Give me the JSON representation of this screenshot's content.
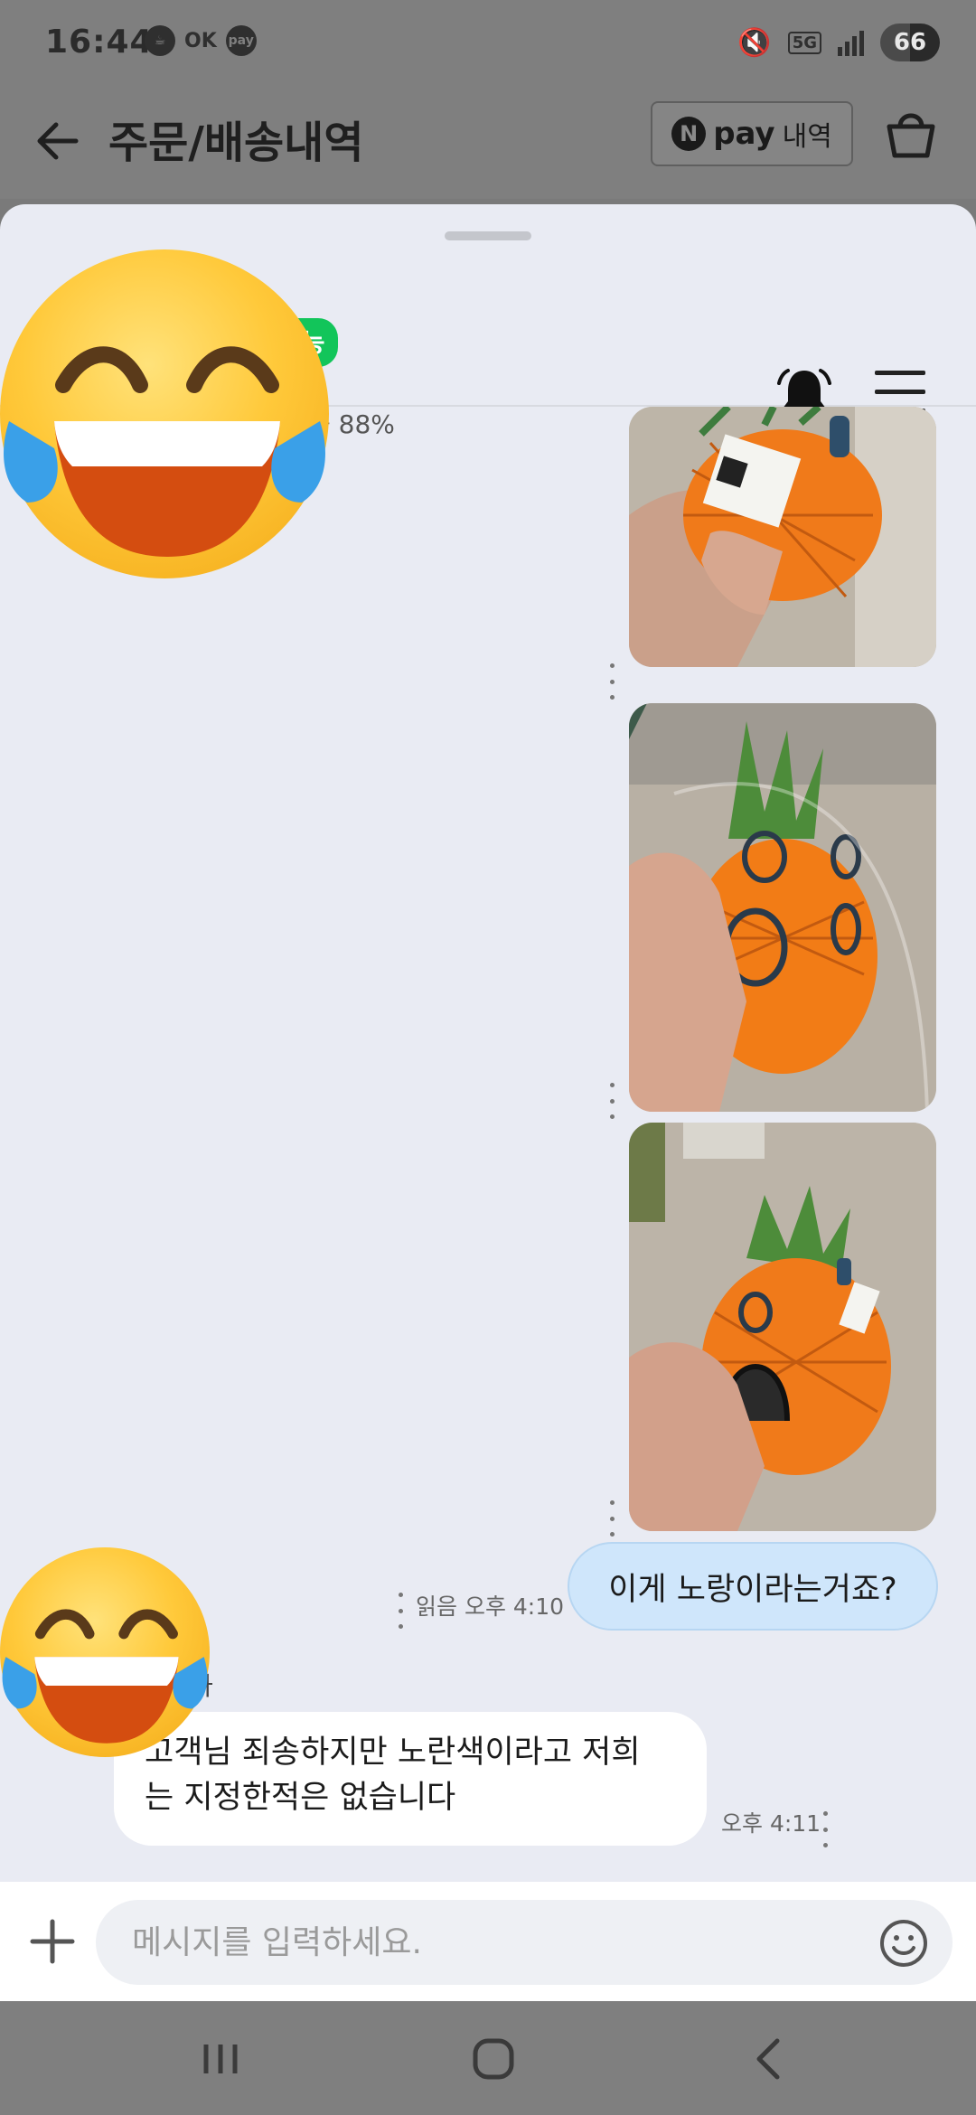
{
  "status_bar": {
    "time": "16:44",
    "ok_label": "OK",
    "pay_label": "pay",
    "network": "5G",
    "battery": "66"
  },
  "header": {
    "title": "주문/배송내역",
    "pay_n": "N",
    "pay_word": "pay",
    "pay_history": "내역"
  },
  "chat": {
    "reply_badge": "가능",
    "reply_rate": "률 88%",
    "messages": {
      "me_text": "이게 노랑이라는거죠?",
      "me_meta": "읽음  오후 4:10",
      "sender_fragment": "아",
      "them_line1": "고객님 죄송하지만 노란색이라고 저희",
      "them_line2": "는 지정한적은 없습니다",
      "them_time": "오후 4:11"
    }
  },
  "input": {
    "placeholder": "메시지를 입력하세요."
  },
  "colors": {
    "sheet_bg": "#e9ebf3",
    "my_bubble": "#cfe6fb",
    "badge_green": "#12c55a"
  },
  "icons": [
    "back-arrow-icon",
    "cart-icon",
    "bell-icon",
    "menu-icon",
    "plus-icon",
    "smile-icon",
    "laughing-tears-emoji"
  ]
}
